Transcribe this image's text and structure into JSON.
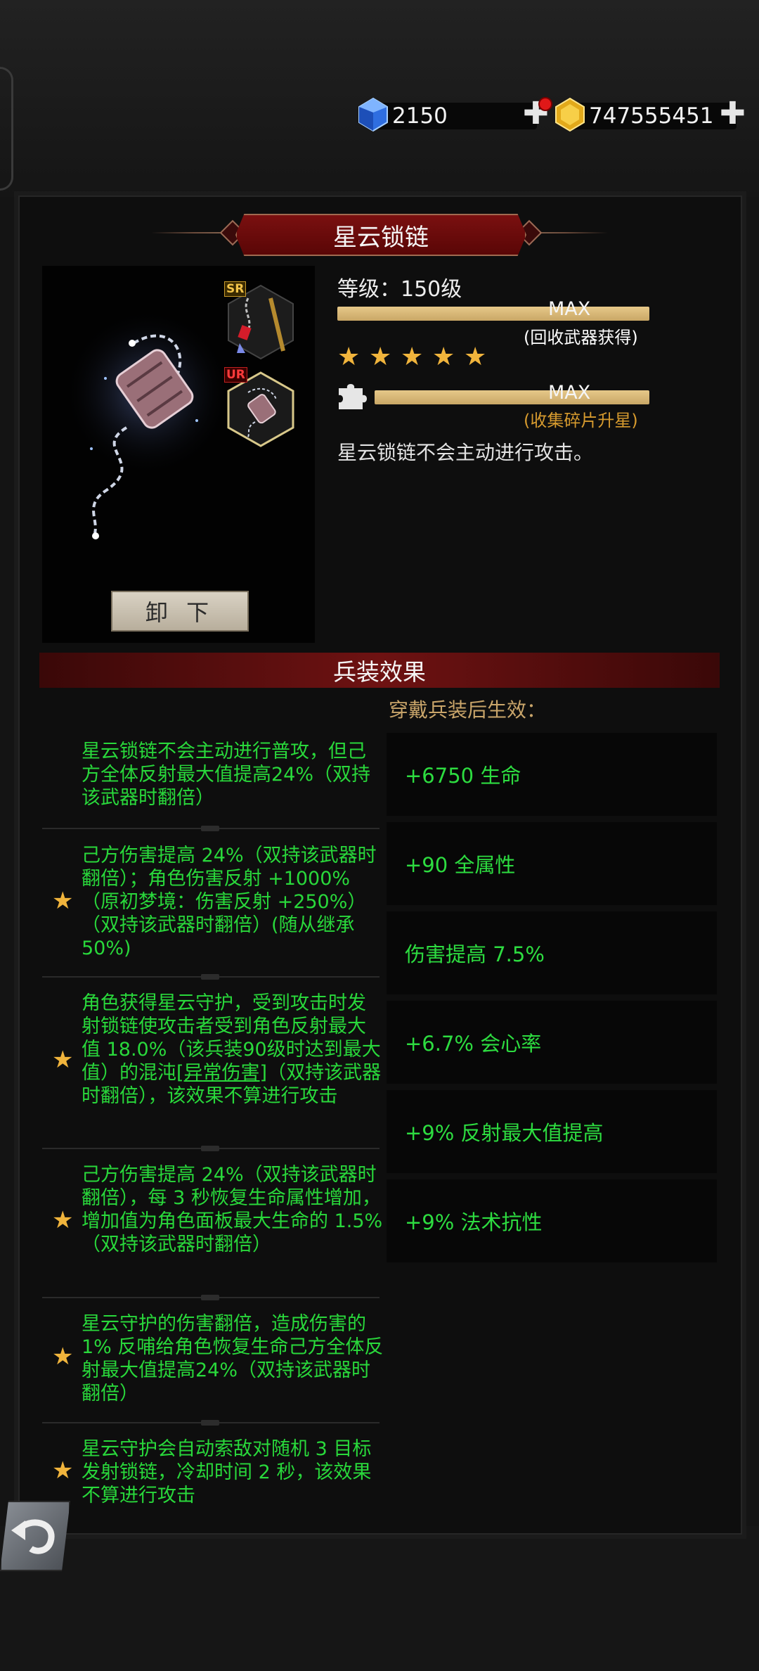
{
  "currency": {
    "gems": "2150",
    "gold": "747555451",
    "gem_icon": "blue-gem-icon",
    "gold_icon": "gold-coin-icon",
    "plus_icon": "plus-icon"
  },
  "weapon": {
    "name": "星云锁链",
    "level_text": "等级：150级",
    "level_bar_text": "MAX",
    "level_sub": "(回收武器获得)",
    "stars": 5,
    "star_bar_text": "MAX",
    "star_sub": "(收集碎片升星)",
    "description": "星云锁链不会主动进行攻击。",
    "badge_sr": "SR",
    "badge_ur": "UR",
    "remove_button": "卸 下"
  },
  "effects": {
    "title": "兵装效果",
    "wear_label": "穿戴兵装后生效：",
    "items": [
      {
        "starred": false,
        "text": "星云锁链不会主动进行普攻，但己方全体反射最大值提高24%（双持该武器时翻倍）"
      },
      {
        "starred": true,
        "text": "己方伤害提高 24%（双持该武器时翻倍）；角色伤害反射 +1000%（原初梦境：伤害反射 +250%）（双持该武器时翻倍）(随从继承 50%)"
      },
      {
        "starred": true,
        "text_before": "角色获得星云守护，受到攻击时发射锁链使攻击者受到角色反射最大值 18.0%（该兵装90级时达到最大值）的混沌[",
        "link": "异常伤害",
        "text_after": "]（双持该武器时翻倍），该效果不算进行攻击"
      },
      {
        "starred": true,
        "text": "己方伤害提高 24%（双持该武器时翻倍），每 3 秒恢复生命属性增加，增加值为角色面板最大生命的 1.5%（双持该武器时翻倍）"
      },
      {
        "starred": true,
        "text": "星云守护的伤害翻倍，造成伤害的 1% 反哺给角色恢复生命己方全体反射最大值提高24%（双持该武器时翻倍）"
      },
      {
        "starred": true,
        "text": "星云守护会自动索敌对随机 3 目标发射锁链，冷却时间 2 秒，该效果不算进行攻击"
      }
    ]
  },
  "stats": [
    "+6750 生命",
    "+90 全属性",
    "伤害提高 7.5%",
    "+6.7% 会心率",
    "+9% 反射最大值提高",
    "+9% 法术抗性"
  ],
  "colors": {
    "effect_green": "#29d83b",
    "star_gold": "#f0b43c",
    "bar_gold": "#d9b877",
    "header_red": "#6e1212",
    "label_gold": "#c9a56a"
  }
}
